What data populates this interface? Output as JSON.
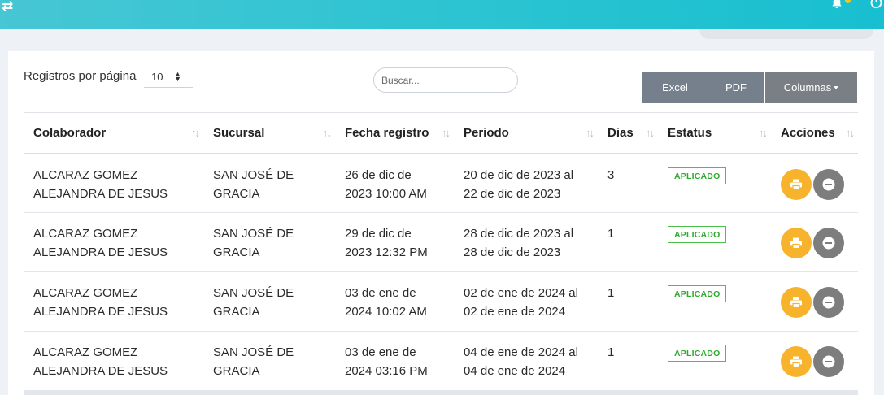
{
  "header": {
    "swap_icon": "swap-arrows-icon",
    "bell_icon": "bell-icon",
    "power_icon": "power-icon",
    "swap_glyph": "⇄"
  },
  "controls": {
    "per_page_label": "Registros por página",
    "per_page_value": "10",
    "search_placeholder": "Buscar...",
    "excel_label": "Excel",
    "pdf_label": "PDF",
    "columns_label": "Columnas"
  },
  "table": {
    "columns": [
      "Colaborador",
      "Sucursal",
      "Fecha registro",
      "Periodo",
      "Dias",
      "Estatus",
      "Acciones"
    ],
    "rows": [
      {
        "colaborador": [
          "ALCARAZ GOMEZ",
          "ALEJANDRA DE JESUS"
        ],
        "sucursal": [
          "SAN JOSÉ DE",
          "GRACIA"
        ],
        "fecha": [
          "26 de dic de",
          "2023 10:00 AM"
        ],
        "periodo": [
          "20 de dic de 2023 al",
          "22 de dic de 2023"
        ],
        "dias": "3",
        "estatus": "APLICADO"
      },
      {
        "colaborador": [
          "ALCARAZ GOMEZ",
          "ALEJANDRA DE JESUS"
        ],
        "sucursal": [
          "SAN JOSÉ DE",
          "GRACIA"
        ],
        "fecha": [
          "29 de dic de",
          "2023 12:32 PM"
        ],
        "periodo": [
          "28 de dic de 2023 al",
          "28 de dic de 2023"
        ],
        "dias": "1",
        "estatus": "APLICADO"
      },
      {
        "colaborador": [
          "ALCARAZ GOMEZ",
          "ALEJANDRA DE JESUS"
        ],
        "sucursal": [
          "SAN JOSÉ DE",
          "GRACIA"
        ],
        "fecha": [
          "03 de ene de",
          "2024 10:02 AM"
        ],
        "periodo": [
          "02 de ene de 2024 al",
          "02 de ene de 2024"
        ],
        "dias": "1",
        "estatus": "APLICADO"
      },
      {
        "colaborador": [
          "ALCARAZ GOMEZ",
          "ALEJANDRA DE JESUS"
        ],
        "sucursal": [
          "SAN JOSÉ DE",
          "GRACIA"
        ],
        "fecha": [
          "03 de ene de",
          "2024 03:16 PM"
        ],
        "periodo": [
          "04 de ene de 2024 al",
          "04 de ene de 2024"
        ],
        "dias": "1",
        "estatus": "APLICADO"
      }
    ],
    "row_actions": [
      "print-icon",
      "minus-circle-icon"
    ]
  },
  "colors": {
    "header_gradient_start": "#47c6d4",
    "header_gradient_end": "#18bfd0",
    "status_green": "#2eaa2e",
    "print_button": "#f7b32b",
    "minus_button": "#7d7d7d",
    "export_button": "#75808c"
  }
}
